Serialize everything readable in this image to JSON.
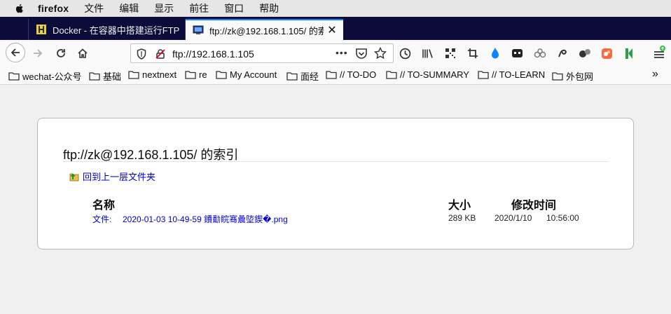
{
  "menubar": {
    "app_name": "firefox",
    "items": [
      "文件",
      "编辑",
      "显示",
      "前往",
      "窗口",
      "帮助"
    ]
  },
  "tabs": [
    {
      "title": "Docker - 在容器中搭建运行FTP",
      "favicon": "docker-icon",
      "active": false
    },
    {
      "title": "ftp://zk@192.168.1.105/ 的索引",
      "favicon": "monitor-icon",
      "active": true
    }
  ],
  "window_controls": {
    "minimize": "—",
    "maximize": "☐",
    "close": "✕"
  },
  "navbar": {
    "url": "ftp://192.168.1.105",
    "page_actions": "•••"
  },
  "bookmarks": [
    "wechat-公众号",
    "基础",
    "nextnext",
    "re",
    "My Account",
    "面经",
    "// TO-DO",
    "// TO-SUMMARY",
    "// TO-LEARN",
    "外包网"
  ],
  "listing": {
    "title": "ftp://zk@192.168.1.105/ 的索引",
    "parent_link": "回到上一层文件夹",
    "columns": {
      "name": "名称",
      "size": "大小",
      "modified": "修改时间"
    },
    "rows": [
      {
        "type_label": "文件:",
        "name": "2020-01-03 10-49-59 鐨勫睆骞曟埅鍥�.png",
        "size": "289 KB",
        "date": "2020/1/10",
        "time": "10:56:00"
      }
    ]
  },
  "colors": {
    "tabbar": "#0c0c3a",
    "accent": "#0a84ff",
    "link": "#0000cc"
  }
}
